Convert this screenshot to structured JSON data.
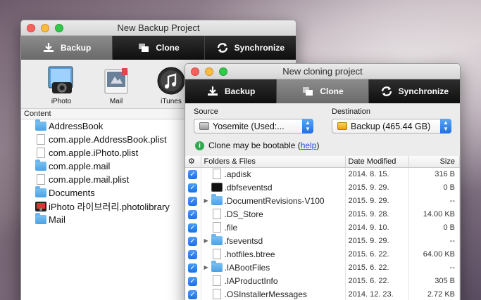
{
  "backup_window": {
    "title": "New Backup Project",
    "toolbar": {
      "backup": "Backup",
      "clone": "Clone",
      "synchronize": "Synchronize"
    },
    "apps": [
      {
        "label": "iPhoto",
        "icon": "iphoto-icon"
      },
      {
        "label": "Mail",
        "icon": "mail-icon"
      },
      {
        "label": "iTunes",
        "icon": "itunes-icon"
      }
    ],
    "content_header": "Content",
    "items": [
      {
        "name": "AddressBook",
        "type": "folder"
      },
      {
        "name": "com.apple.AddressBook.plist",
        "type": "doc"
      },
      {
        "name": "com.apple.iPhoto.plist",
        "type": "doc"
      },
      {
        "name": "com.apple.mail",
        "type": "folder"
      },
      {
        "name": "com.apple.mail.plist",
        "type": "doc"
      },
      {
        "name": "Documents",
        "type": "folder"
      },
      {
        "name": "iPhoto 라이브러리.photolibrary",
        "type": "photolibrary"
      },
      {
        "name": "Mail",
        "type": "folder"
      }
    ]
  },
  "clone_window": {
    "title": "New cloning project",
    "toolbar": {
      "backup": "Backup",
      "clone": "Clone",
      "synchronize": "Synchronize"
    },
    "source_label": "Source",
    "source_value": "Yosemite (Used:...",
    "destination_label": "Destination",
    "destination_value": "Backup (465.44 GB)",
    "bootable_text": "Clone may be bootable (",
    "help_link": "help",
    "bootable_close": ")",
    "columns": {
      "folders": "Folders & Files",
      "date": "Date Modified",
      "size": "Size"
    },
    "rows": [
      {
        "name": ".apdisk",
        "date": "2014. 8. 15.",
        "size": "316 B",
        "type": "doc",
        "expand": false
      },
      {
        "name": ".dbfseventsd",
        "date": "2015. 9. 29.",
        "size": "0 B",
        "type": "terminal",
        "expand": false
      },
      {
        "name": ".DocumentRevisions-V100",
        "date": "2015. 9. 29.",
        "size": "--",
        "type": "folder",
        "expand": true
      },
      {
        "name": ".DS_Store",
        "date": "2015. 9. 28.",
        "size": "14.00 KB",
        "type": "doc",
        "expand": false
      },
      {
        "name": ".file",
        "date": "2014. 9. 10.",
        "size": "0 B",
        "type": "doc",
        "expand": false
      },
      {
        "name": ".fseventsd",
        "date": "2015. 9. 29.",
        "size": "--",
        "type": "folder",
        "expand": true
      },
      {
        "name": ".hotfiles.btree",
        "date": "2015. 6. 22.",
        "size": "64.00 KB",
        "type": "doc",
        "expand": false
      },
      {
        "name": ".IABootFiles",
        "date": "2015. 6. 22.",
        "size": "--",
        "type": "folder",
        "expand": true
      },
      {
        "name": ".IAProductInfo",
        "date": "2015. 6. 22.",
        "size": "305 B",
        "type": "doc",
        "expand": false
      },
      {
        "name": ".OSInstallerMessages",
        "date": "2014. 12. 23.",
        "size": "2.72 KB",
        "type": "doc",
        "expand": false
      }
    ]
  }
}
